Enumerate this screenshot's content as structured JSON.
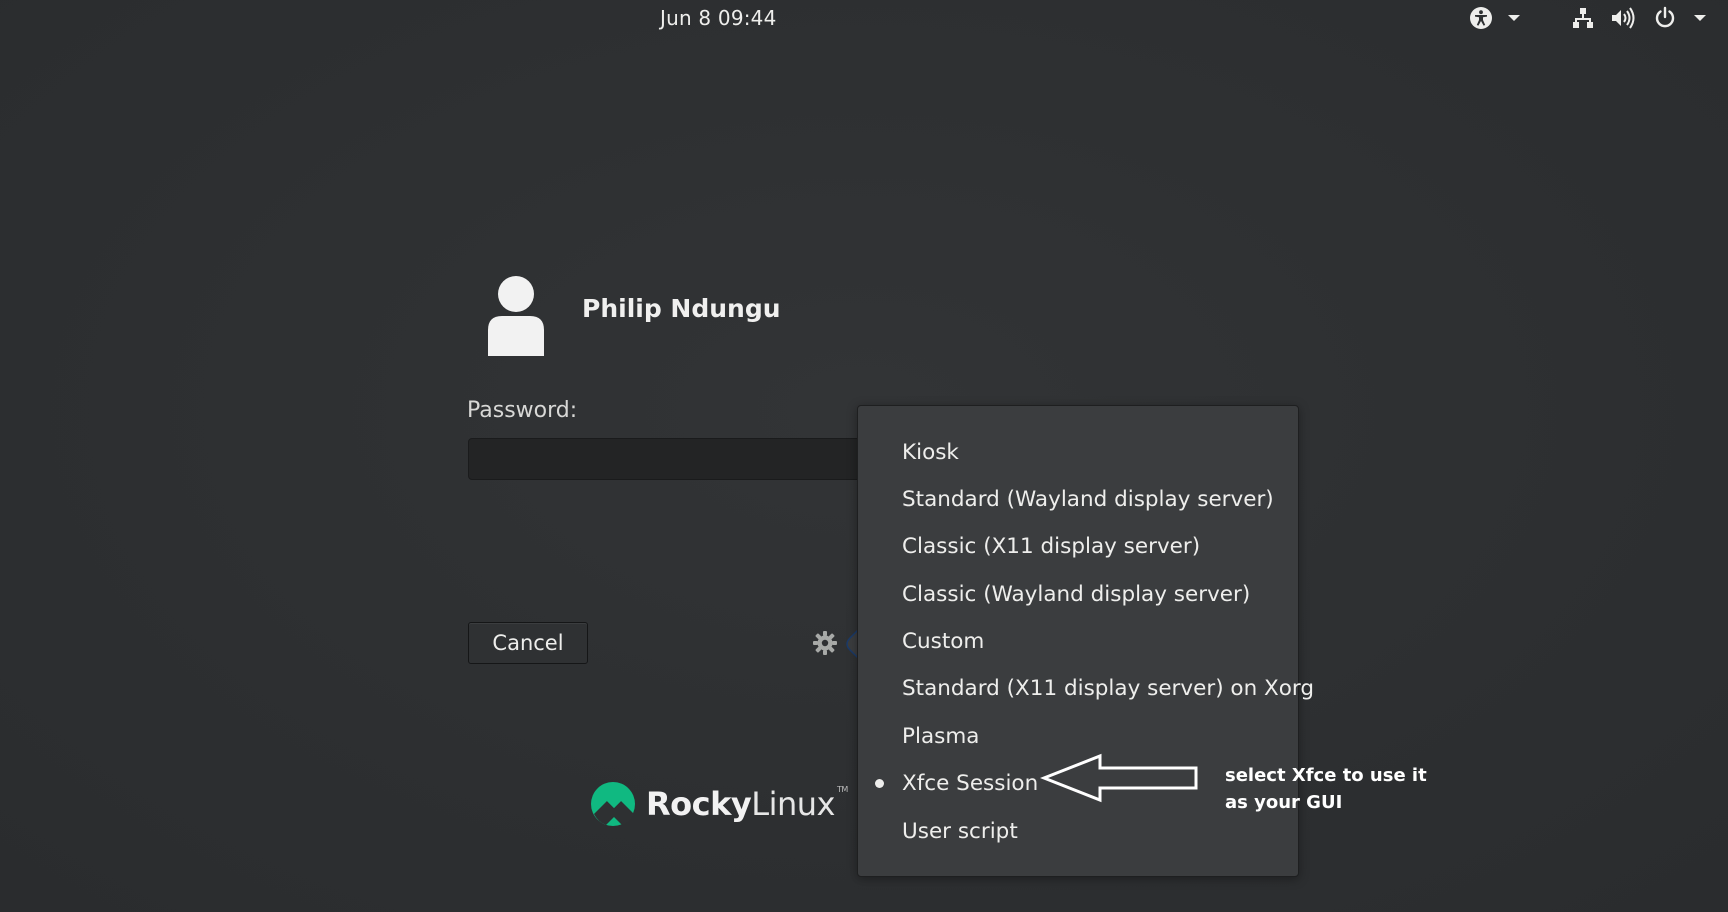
{
  "topbar": {
    "datetime": "Jun 8  09:44",
    "icons": [
      "accessibility-icon",
      "chevron-down-icon",
      "network-icon",
      "volume-icon",
      "power-icon",
      "chevron-down-icon"
    ]
  },
  "login": {
    "user_name": "Philip Ndungu",
    "password_label": "Password:",
    "password_value": "",
    "cancel_label": "Cancel",
    "session_icon": "gear-icon"
  },
  "session_menu": {
    "items": [
      {
        "label": "Kiosk",
        "selected": false
      },
      {
        "label": "Standard (Wayland display server)",
        "selected": false
      },
      {
        "label": "Classic (X11 display server)",
        "selected": false
      },
      {
        "label": "Classic (Wayland display server)",
        "selected": false
      },
      {
        "label": "Custom",
        "selected": false
      },
      {
        "label": "Standard (X11 display server) on Xorg",
        "selected": false
      },
      {
        "label": "Plasma",
        "selected": false
      },
      {
        "label": "Xfce Session",
        "selected": true
      },
      {
        "label": "User script",
        "selected": false
      }
    ]
  },
  "annotation": {
    "text": "select Xfce to use it as your GUI"
  },
  "branding": {
    "logo_strong": "Rocky",
    "logo_light": "Linux",
    "logo_mark": "TM",
    "accent_color": "#10b981"
  }
}
